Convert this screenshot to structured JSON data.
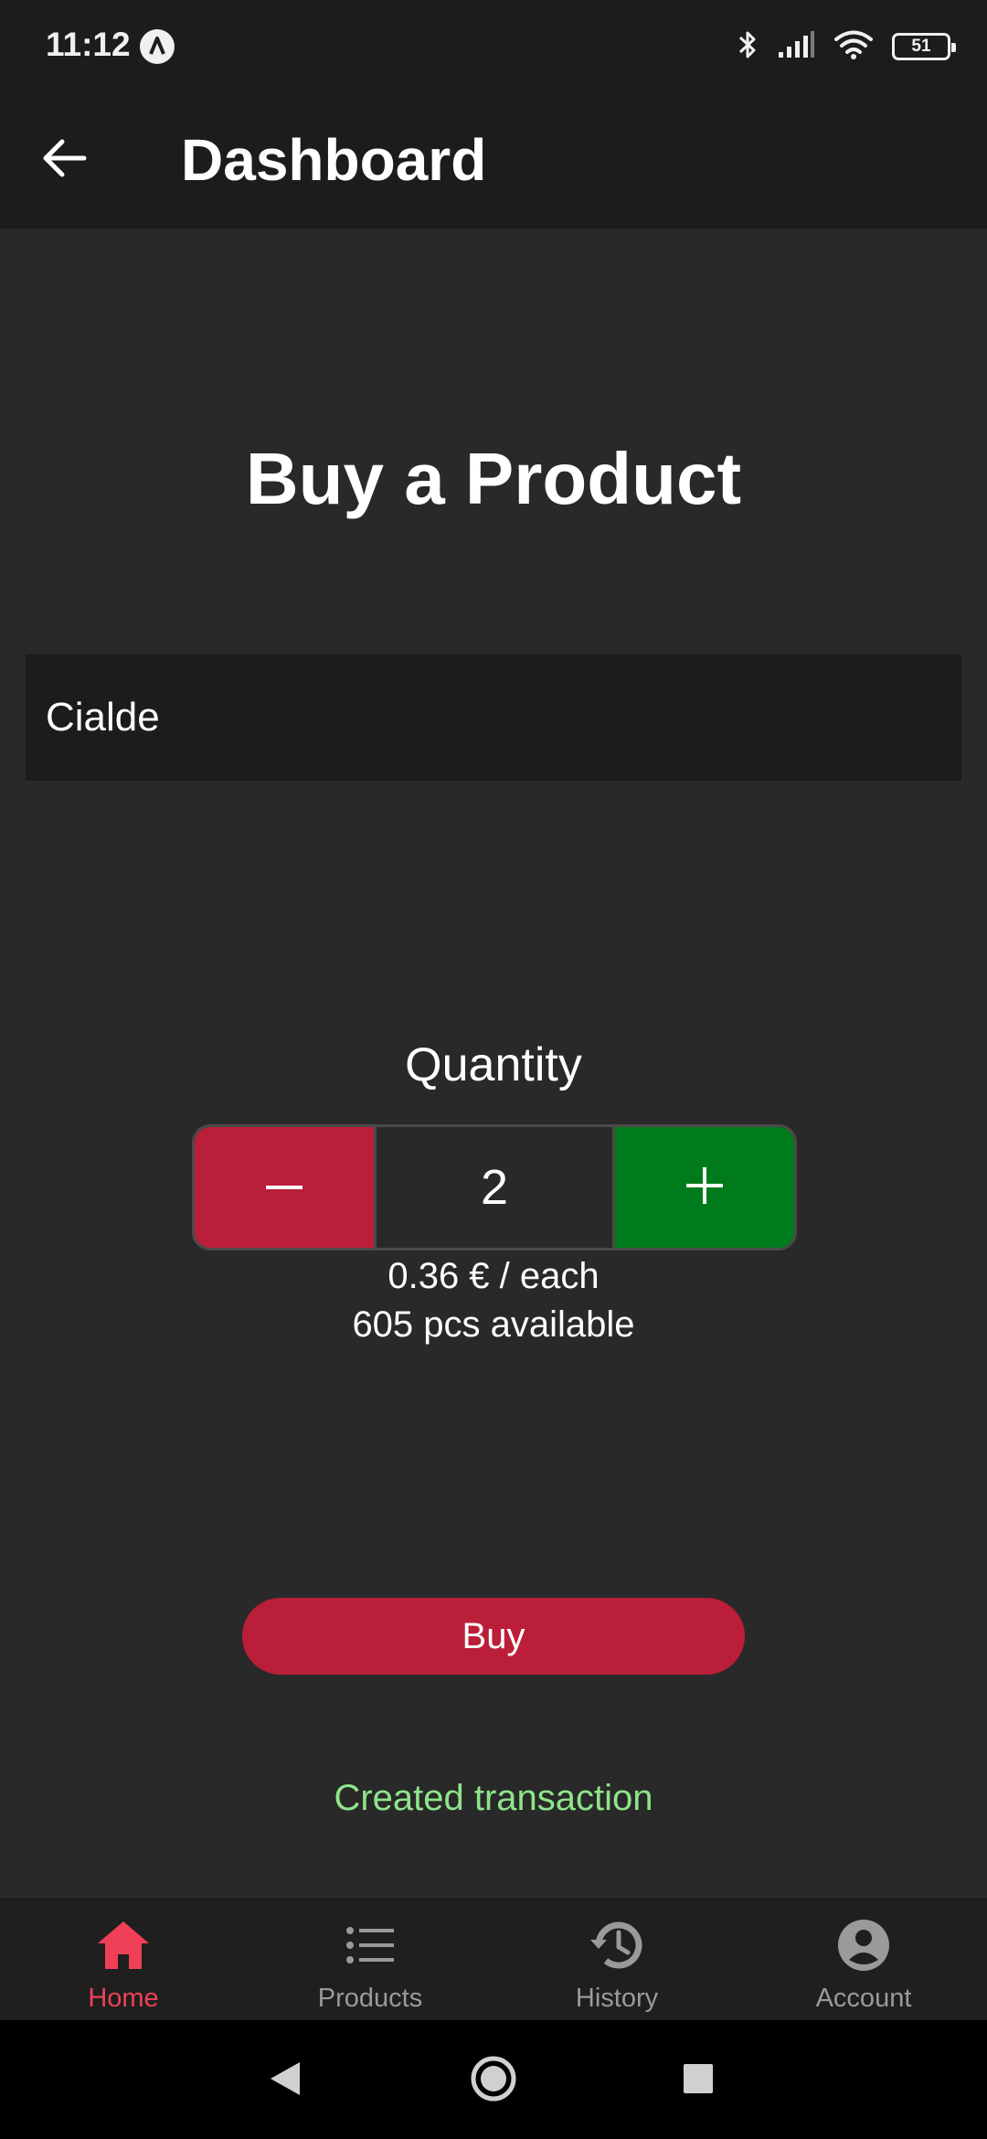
{
  "status_bar": {
    "time": "11:12",
    "battery": "51",
    "icons": [
      "app-notification-icon",
      "bluetooth-icon",
      "signal-icon",
      "wifi-icon",
      "battery-icon"
    ]
  },
  "app_bar": {
    "title": "Dashboard",
    "back_icon": "arrow-left-icon"
  },
  "main": {
    "heading": "Buy a Product",
    "product": "Cialde",
    "quantity_label": "Quantity",
    "quantity_value": "2",
    "minus_symbol": "−",
    "plus_symbol": "+",
    "price_each": "0.36 € / each",
    "available": "605 pcs available",
    "buy_label": "Buy",
    "status_message": "Created transaction"
  },
  "bottom_nav": {
    "items": [
      {
        "label": "Home",
        "icon": "home-icon",
        "active": true
      },
      {
        "label": "Products",
        "icon": "list-icon",
        "active": false
      },
      {
        "label": "History",
        "icon": "history-icon",
        "active": false
      },
      {
        "label": "Account",
        "icon": "account-icon",
        "active": false
      }
    ]
  },
  "colors": {
    "accent": "#ef4058",
    "minus_button": "#bb1e38",
    "plus_button": "#007b1c",
    "success_text": "#8ee58a",
    "background": "#292929",
    "surface": "#1c1c1c"
  }
}
